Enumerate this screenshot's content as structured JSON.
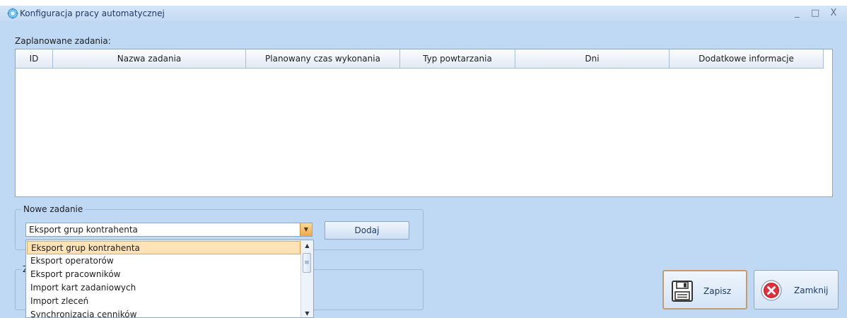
{
  "window": {
    "title": "Konfiguracja pracy automatycznej",
    "controls": {
      "minimize": "_",
      "maximize": "□",
      "close": "X"
    }
  },
  "scheduled": {
    "label": "Zaplanowane zadania:",
    "columns": [
      "ID",
      "Nazwa zadania",
      "Planowany czas wykonania",
      "Typ powtarzania",
      "Dni",
      "Dodatkowe informacje"
    ],
    "rows": []
  },
  "new_task": {
    "group_label": "Nowe zadanie",
    "selected_value": "Eksport grup kontrahenta",
    "add_label": "Dodaj",
    "options": [
      "Eksport grup kontrahenta",
      "Eksport operatorów",
      "Eksport pracowników",
      "Import kart zadaniowych",
      "Import zleceń",
      "Synchronizacja cenników"
    ]
  },
  "second_group": {
    "label_partial": "Z"
  },
  "actions": {
    "save_label": "Zapisz",
    "close_label": "Zamknij"
  },
  "colors": {
    "window_bg": "#bfd8f4",
    "selected_item_bg": "#fde3b5",
    "close_icon_red": "#e0303c",
    "accent_orange": "#f0a64b"
  }
}
